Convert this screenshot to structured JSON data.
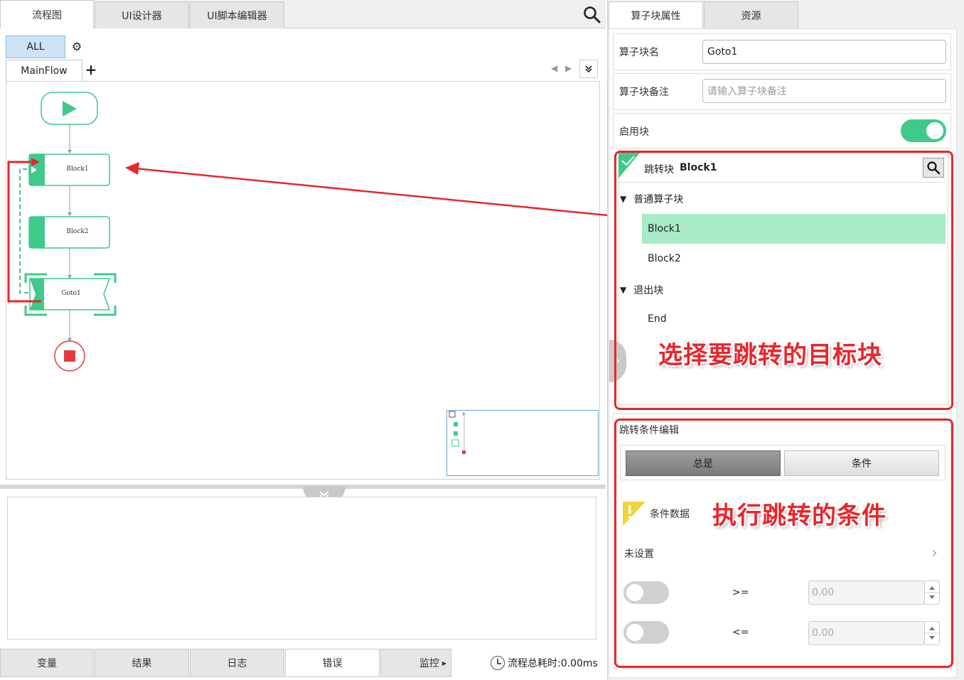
{
  "top_tabs": [
    "流程图",
    "UI设计器",
    "UI脚本编辑器"
  ],
  "filter_all": "ALL",
  "flow_tab": "MainFlow",
  "flow_nodes": {
    "block1": "Block1",
    "block2": "Block2",
    "goto1": "Goto1"
  },
  "bottom_tabs": [
    "变量",
    "结果",
    "日志",
    "错误",
    "监控"
  ],
  "elapsed": "流程总耗时:0.00ms",
  "right_tabs": [
    "算子块属性",
    "资源"
  ],
  "props": {
    "name_label": "算子块名",
    "name_value": "Goto1",
    "note_label": "算子块备注",
    "note_placeholder": "请输入算子块备注",
    "enable_label": "启用块"
  },
  "jump": {
    "title_prefix": "跳转块",
    "title_target": "Block1",
    "group_normal": "普通算子块",
    "items_normal": [
      "Block1",
      "Block2"
    ],
    "group_exit": "退出块",
    "items_exit": [
      "End"
    ]
  },
  "condition": {
    "section_title": "跳转条件编辑",
    "btn_always": "总是",
    "btn_condition": "条件",
    "data_label": "条件数据",
    "unset": "未设置",
    "ops": [
      ">=",
      "<="
    ],
    "values": [
      "0.00",
      "0.00"
    ]
  },
  "annotations": {
    "select_target": "选择要跳转的目标块",
    "condition": "执行跳转的条件"
  },
  "colors": {
    "accent": "#3fc98a",
    "selected_row": "#a8ebc6",
    "annotation": "#e8262c",
    "stop": "#e23a3a"
  }
}
